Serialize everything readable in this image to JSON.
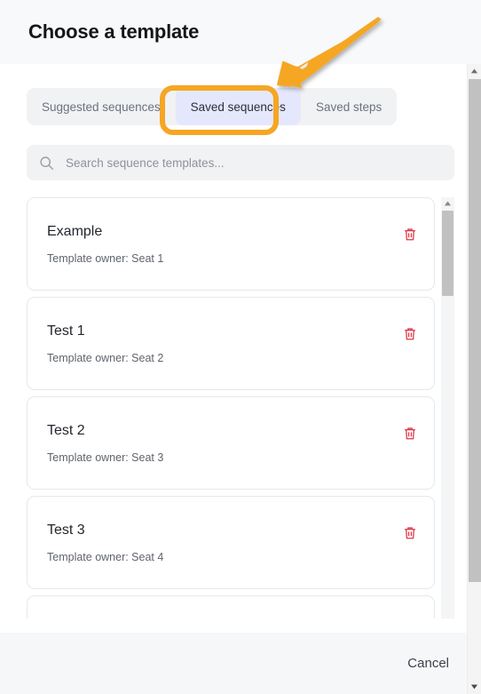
{
  "window": {
    "title": "Choose a template"
  },
  "tabs": [
    {
      "label": "Suggested sequences",
      "selected": false
    },
    {
      "label": "Saved sequences",
      "selected": true
    },
    {
      "label": "Saved steps",
      "selected": false
    }
  ],
  "search": {
    "placeholder": "Search sequence templates...",
    "value": "",
    "icon": "search-icon"
  },
  "templates": [
    {
      "name": "Example",
      "owner": "Template owner: Seat 1",
      "delete_icon": "trash-icon"
    },
    {
      "name": "Test 1",
      "owner": "Template owner: Seat 2",
      "delete_icon": "trash-icon"
    },
    {
      "name": "Test 2",
      "owner": "Template owner: Seat 3",
      "delete_icon": "trash-icon"
    },
    {
      "name": "Test 3",
      "owner": "Template owner: Seat 4",
      "delete_icon": "trash-icon"
    }
  ],
  "footer": {
    "cancel_label": "Cancel"
  },
  "scrollbars": {
    "list_up_icon": "caret-up-icon",
    "window_up_icon": "caret-up-icon",
    "window_down_icon": "caret-down-icon"
  },
  "annotation": {
    "highlight_color": "#f5a623",
    "arrow_color": "#f5a623",
    "target": "Saved sequences"
  },
  "colors": {
    "header_bg": "#f8f9fb",
    "footer_bg": "#f6f7f9",
    "tab_group_bg": "#f1f2f4",
    "tab_selected_bg": "#e5e8fd",
    "delete_red": "#dc3545",
    "card_border": "#e6e8ea"
  }
}
